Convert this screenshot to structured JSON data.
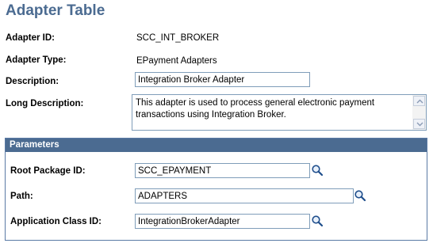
{
  "page": {
    "title": "Adapter Table"
  },
  "adapter": {
    "id_label": "Adapter ID:",
    "id_value": "SCC_INT_BROKER",
    "type_label": "Adapter Type:",
    "type_value": "EPayment Adapters",
    "description_label": "Description:",
    "description_value": "Integration Broker Adapter",
    "long_description_label": "Long Description:",
    "long_description_value": "This adapter is used to process general electronic payment transactions using Integration Broker."
  },
  "parameters": {
    "header": "Parameters",
    "root_package_label": "Root Package ID:",
    "root_package_value": "SCC_EPAYMENT",
    "path_label": "Path:",
    "path_value": "ADAPTERS",
    "app_class_label": "Application Class ID:",
    "app_class_value": "IntegrationBrokerAdapter"
  },
  "icons": {
    "lookup": "magnifier-lookup-icon",
    "scroll_up": "scroll-up-arrow-icon",
    "scroll_down": "scroll-down-arrow-icon"
  },
  "colors": {
    "title": "#4b6b91",
    "group_header_bg": "#4b6b91",
    "field_border": "#7f9db9"
  }
}
